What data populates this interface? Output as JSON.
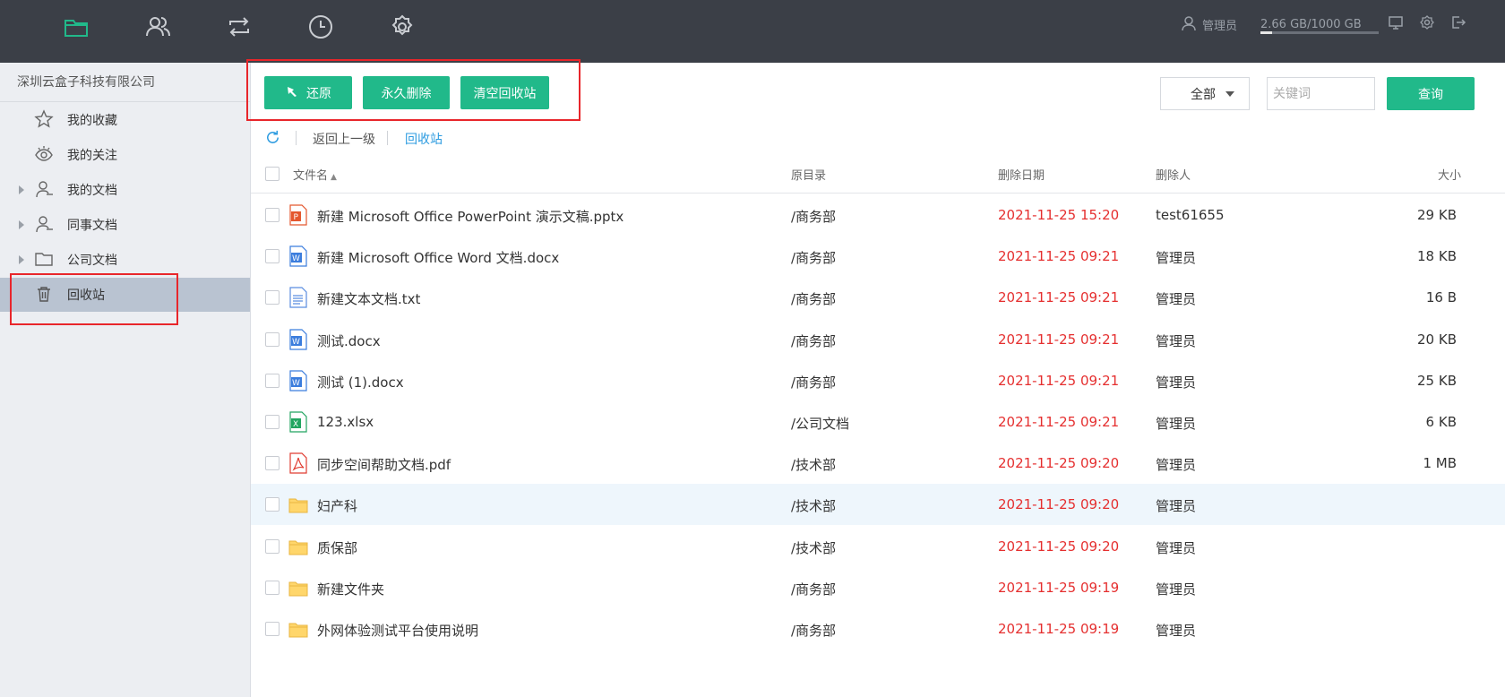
{
  "topbar": {
    "nav_icons": [
      "folder-icon",
      "users-icon",
      "sync-icon",
      "clock-icon",
      "gear-icon"
    ],
    "user_label": "管理员",
    "storage_text": "2.66 GB/1000 GB",
    "storage_used_fraction": 0.00266,
    "right_icons": [
      "monitor-icon",
      "settings-icon",
      "logout-icon"
    ],
    "accent": "#21b98a"
  },
  "sidebar": {
    "company": "深圳云盒子科技有限公司",
    "items": [
      {
        "label": "我的收藏",
        "icon": "star-icon",
        "expandable": false
      },
      {
        "label": "我的关注",
        "icon": "eye-icon",
        "expandable": false
      },
      {
        "label": "我的文档",
        "icon": "user-icon",
        "expandable": true
      },
      {
        "label": "同事文档",
        "icon": "user-icon",
        "expandable": true
      },
      {
        "label": "公司文档",
        "icon": "folder-icon",
        "expandable": true
      },
      {
        "label": "回收站",
        "icon": "trash-icon",
        "expandable": false,
        "active": true
      }
    ]
  },
  "toolbar": {
    "restore_label": "还原",
    "delete_forever_label": "永久删除",
    "empty_recycle_label": "清空回收站",
    "filter_value": "全部",
    "search_placeholder": "关键词",
    "query_label": "查询"
  },
  "breadcrumb": {
    "back_label": "返回上一级",
    "current_label": "回收站"
  },
  "table": {
    "headers": {
      "name": "文件名",
      "origin": "原目录",
      "deleted_date": "删除日期",
      "deleted_by": "删除人",
      "size": "大小"
    },
    "rows": [
      {
        "name": "新建 Microsoft Office PowerPoint 演示文稿.pptx",
        "type": "pptx",
        "origin": "/商务部",
        "date": "2021-11-25 15:20",
        "by": "test61655",
        "size": "29 KB"
      },
      {
        "name": "新建 Microsoft Office Word 文档.docx",
        "type": "docx",
        "origin": "/商务部",
        "date": "2021-11-25 09:21",
        "by": "管理员",
        "size": "18 KB"
      },
      {
        "name": "新建文本文档.txt",
        "type": "txt",
        "origin": "/商务部",
        "date": "2021-11-25 09:21",
        "by": "管理员",
        "size": "16 B"
      },
      {
        "name": "测试.docx",
        "type": "docx",
        "origin": "/商务部",
        "date": "2021-11-25 09:21",
        "by": "管理员",
        "size": "20 KB"
      },
      {
        "name": "测试 (1).docx",
        "type": "docx",
        "origin": "/商务部",
        "date": "2021-11-25 09:21",
        "by": "管理员",
        "size": "25 KB"
      },
      {
        "name": "123.xlsx",
        "type": "xlsx",
        "origin": "/公司文档",
        "date": "2021-11-25 09:21",
        "by": "管理员",
        "size": "6 KB"
      },
      {
        "name": "同步空间帮助文档.pdf",
        "type": "pdf",
        "origin": "/技术部",
        "date": "2021-11-25 09:20",
        "by": "管理员",
        "size": "1 MB"
      },
      {
        "name": "妇产科",
        "type": "folder",
        "origin": "/技术部",
        "date": "2021-11-25 09:20",
        "by": "管理员",
        "size": "",
        "hover": true
      },
      {
        "name": "质保部",
        "type": "folder",
        "origin": "/技术部",
        "date": "2021-11-25 09:20",
        "by": "管理员",
        "size": ""
      },
      {
        "name": "新建文件夹",
        "type": "folder",
        "origin": "/商务部",
        "date": "2021-11-25 09:19",
        "by": "管理员",
        "size": ""
      },
      {
        "name": "外网体验测试平台使用说明",
        "type": "folder",
        "origin": "/商务部",
        "date": "2021-11-25 09:19",
        "by": "管理员",
        "size": ""
      }
    ]
  }
}
